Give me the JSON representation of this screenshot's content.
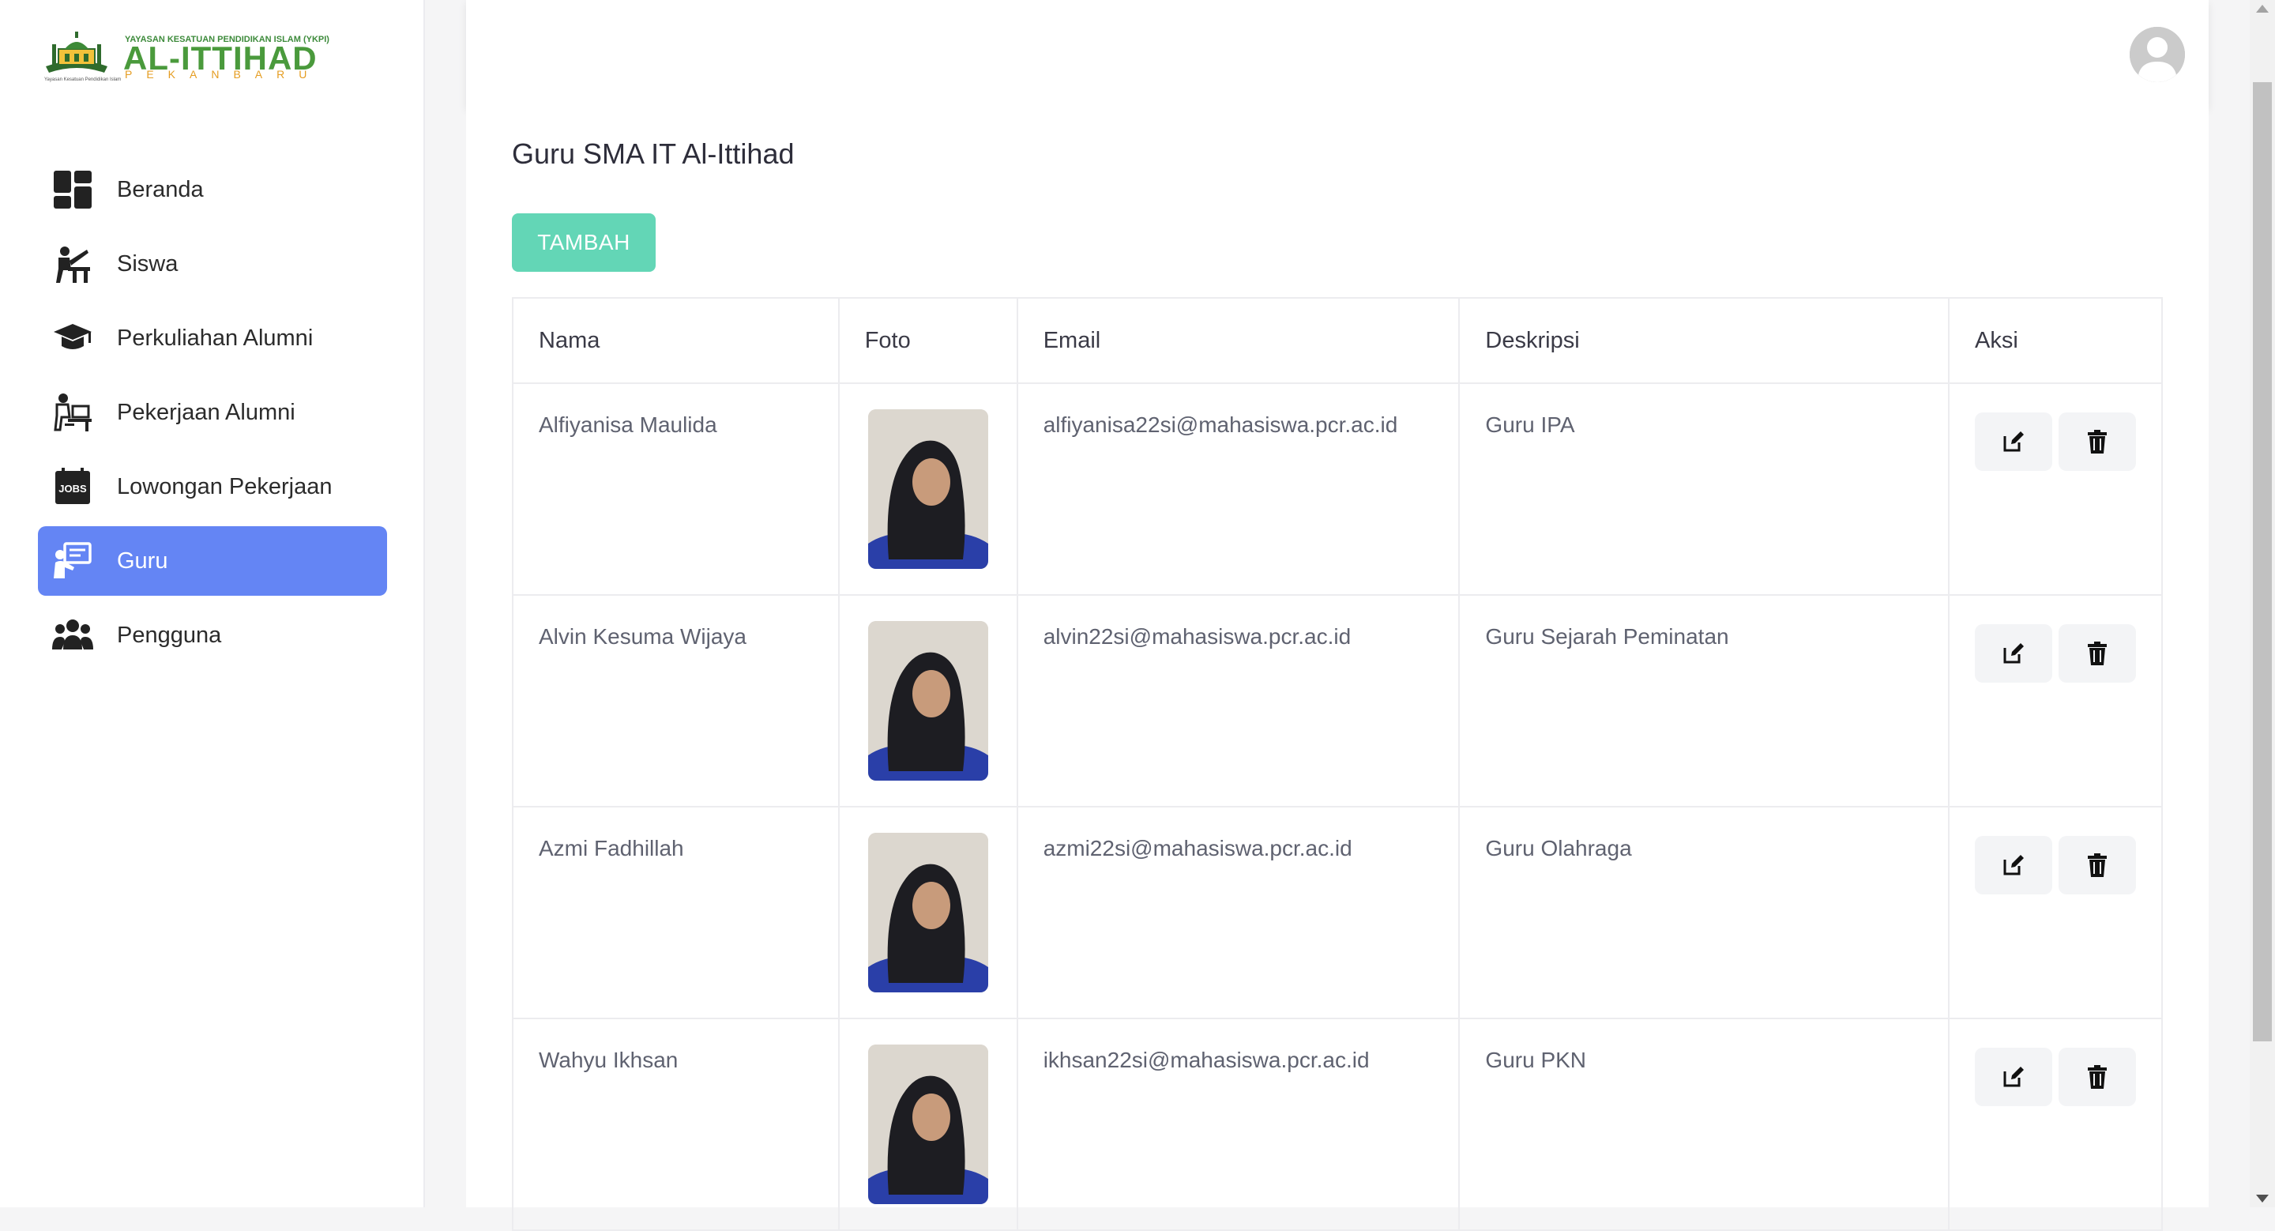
{
  "logo": {
    "top_text": "YAYASAN KESATUAN PENDIDIKAN ISLAM (YKPI)",
    "name": "AL-ITTIHAD",
    "city": "PEKANBARU",
    "tiny_text": "Yayasan Kesatuan Pendidikan Islam"
  },
  "sidebar": {
    "items": [
      {
        "label": "Beranda",
        "icon": "dashboard-icon"
      },
      {
        "label": "Siswa",
        "icon": "student-desk-icon"
      },
      {
        "label": "Perkuliahan Alumni",
        "icon": "graduation-cap-icon"
      },
      {
        "label": "Pekerjaan Alumni",
        "icon": "worker-desk-icon"
      },
      {
        "label": "Lowongan Pekerjaan",
        "icon": "jobs-icon"
      },
      {
        "label": "Guru",
        "icon": "teacher-board-icon",
        "active": true
      },
      {
        "label": "Pengguna",
        "icon": "users-group-icon"
      }
    ]
  },
  "page": {
    "title": "Guru SMA IT Al-Ittihad",
    "add_button": "TAMBAH"
  },
  "table": {
    "headers": [
      "Nama",
      "Foto",
      "Email",
      "Deskripsi",
      "Aksi"
    ],
    "rows": [
      {
        "nama": "Alfiyanisa Maulida",
        "email": "alfiyanisa22si@mahasiswa.pcr.ac.id",
        "deskripsi": "Guru IPA"
      },
      {
        "nama": "Alvin Kesuma Wijaya",
        "email": "alvin22si@mahasiswa.pcr.ac.id",
        "deskripsi": "Guru Sejarah Peminatan"
      },
      {
        "nama": "Azmi Fadhillah",
        "email": "azmi22si@mahasiswa.pcr.ac.id",
        "deskripsi": "Guru Olahraga"
      },
      {
        "nama": "Wahyu Ikhsan",
        "email": "ikhsan22si@mahasiswa.pcr.ac.id",
        "deskripsi": "Guru PKN"
      }
    ]
  },
  "colors": {
    "active_nav": "#6485f4",
    "add_button": "#63d6b6"
  }
}
